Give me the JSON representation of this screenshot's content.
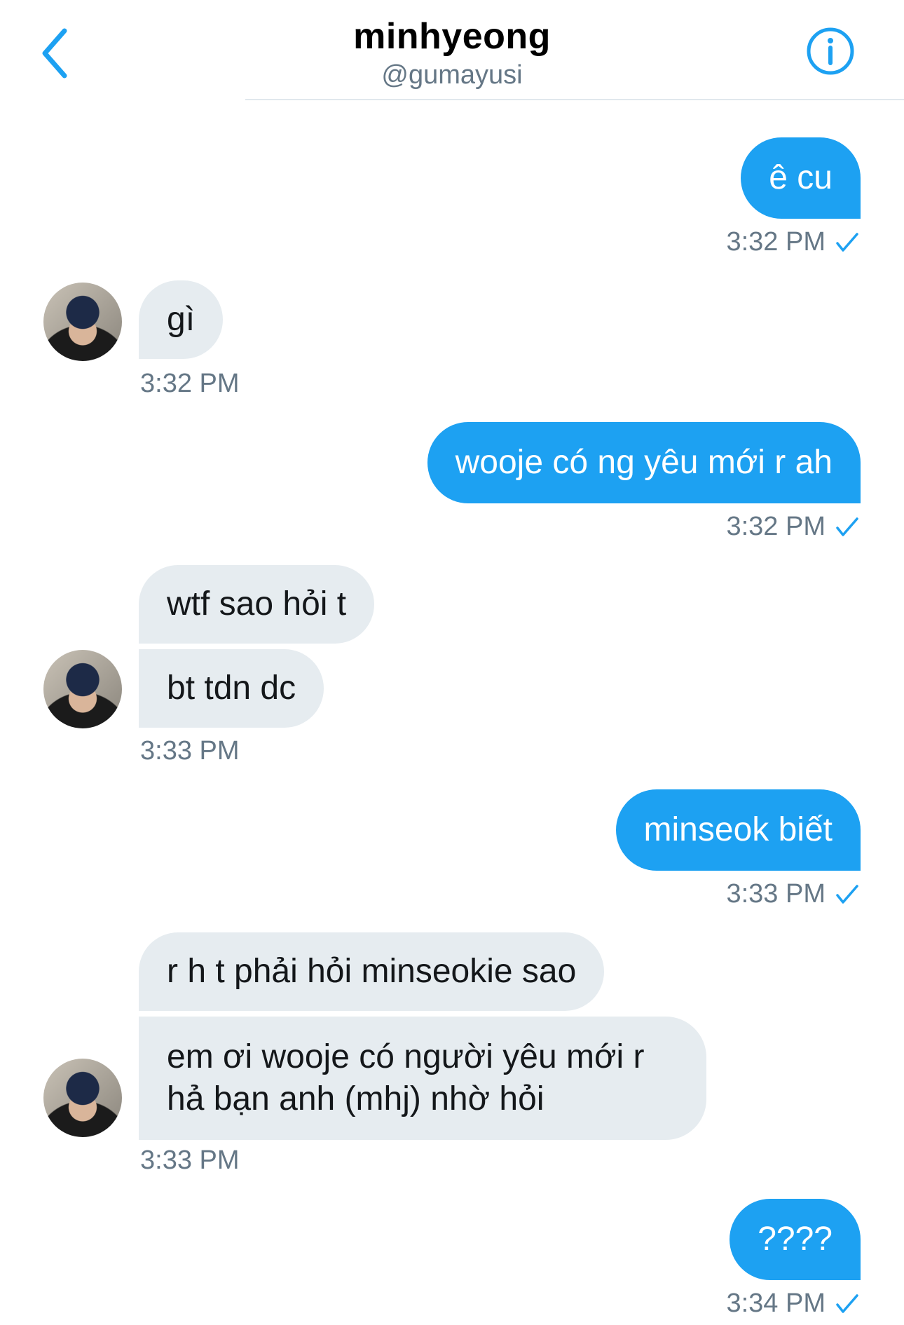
{
  "header": {
    "back_icon": "chevron-left-icon",
    "name": "minhyeong",
    "handle": "@gumayusi",
    "info_icon": "info-circle-icon",
    "accent_color": "#1da1f2"
  },
  "messages": [
    {
      "sender": "me",
      "text": "ê cu",
      "time": "3:32 PM"
    },
    {
      "sender": "them",
      "text": "gì",
      "time": "3:32 PM"
    },
    {
      "sender": "me",
      "text": "wooje có ng yêu mới r ah",
      "time": "3:32 PM"
    },
    {
      "sender": "them",
      "text": "wtf sao hỏi t"
    },
    {
      "sender": "them",
      "text": "bt tdn dc",
      "time": "3:33 PM"
    },
    {
      "sender": "me",
      "text": "minseok biết",
      "time": "3:33 PM"
    },
    {
      "sender": "them",
      "text": "r h t phải hỏi minseokie sao"
    },
    {
      "sender": "them",
      "text": "em ơi wooje có người yêu mới r hả bạn anh (mhj) nhờ hỏi",
      "time": "3:33 PM"
    },
    {
      "sender": "me",
      "text": "????",
      "time": "3:34 PM"
    }
  ],
  "colors": {
    "outgoing_bubble": "#1da1f2",
    "incoming_bubble": "#e6ecf0",
    "timestamp": "#657786"
  }
}
